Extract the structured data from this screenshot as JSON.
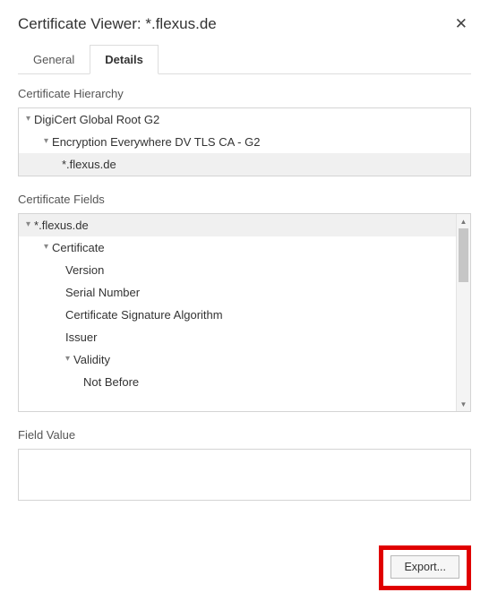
{
  "header": {
    "title": "Certificate Viewer: *.flexus.de"
  },
  "tabs": {
    "general": "General",
    "details": "Details"
  },
  "sections": {
    "hierarchyLabel": "Certificate Hierarchy",
    "fieldsLabel": "Certificate Fields",
    "valueLabel": "Field Value"
  },
  "hierarchy": {
    "root": "DigiCert Global Root G2",
    "intermediate": "Encryption Everywhere DV TLS CA - G2",
    "leaf": "*.flexus.de"
  },
  "fields": {
    "subject": "*.flexus.de",
    "certificate": "Certificate",
    "version": "Version",
    "serial": "Serial Number",
    "sigalg": "Certificate Signature Algorithm",
    "issuer": "Issuer",
    "validity": "Validity",
    "notBefore": "Not Before"
  },
  "footer": {
    "exportLabel": "Export..."
  }
}
